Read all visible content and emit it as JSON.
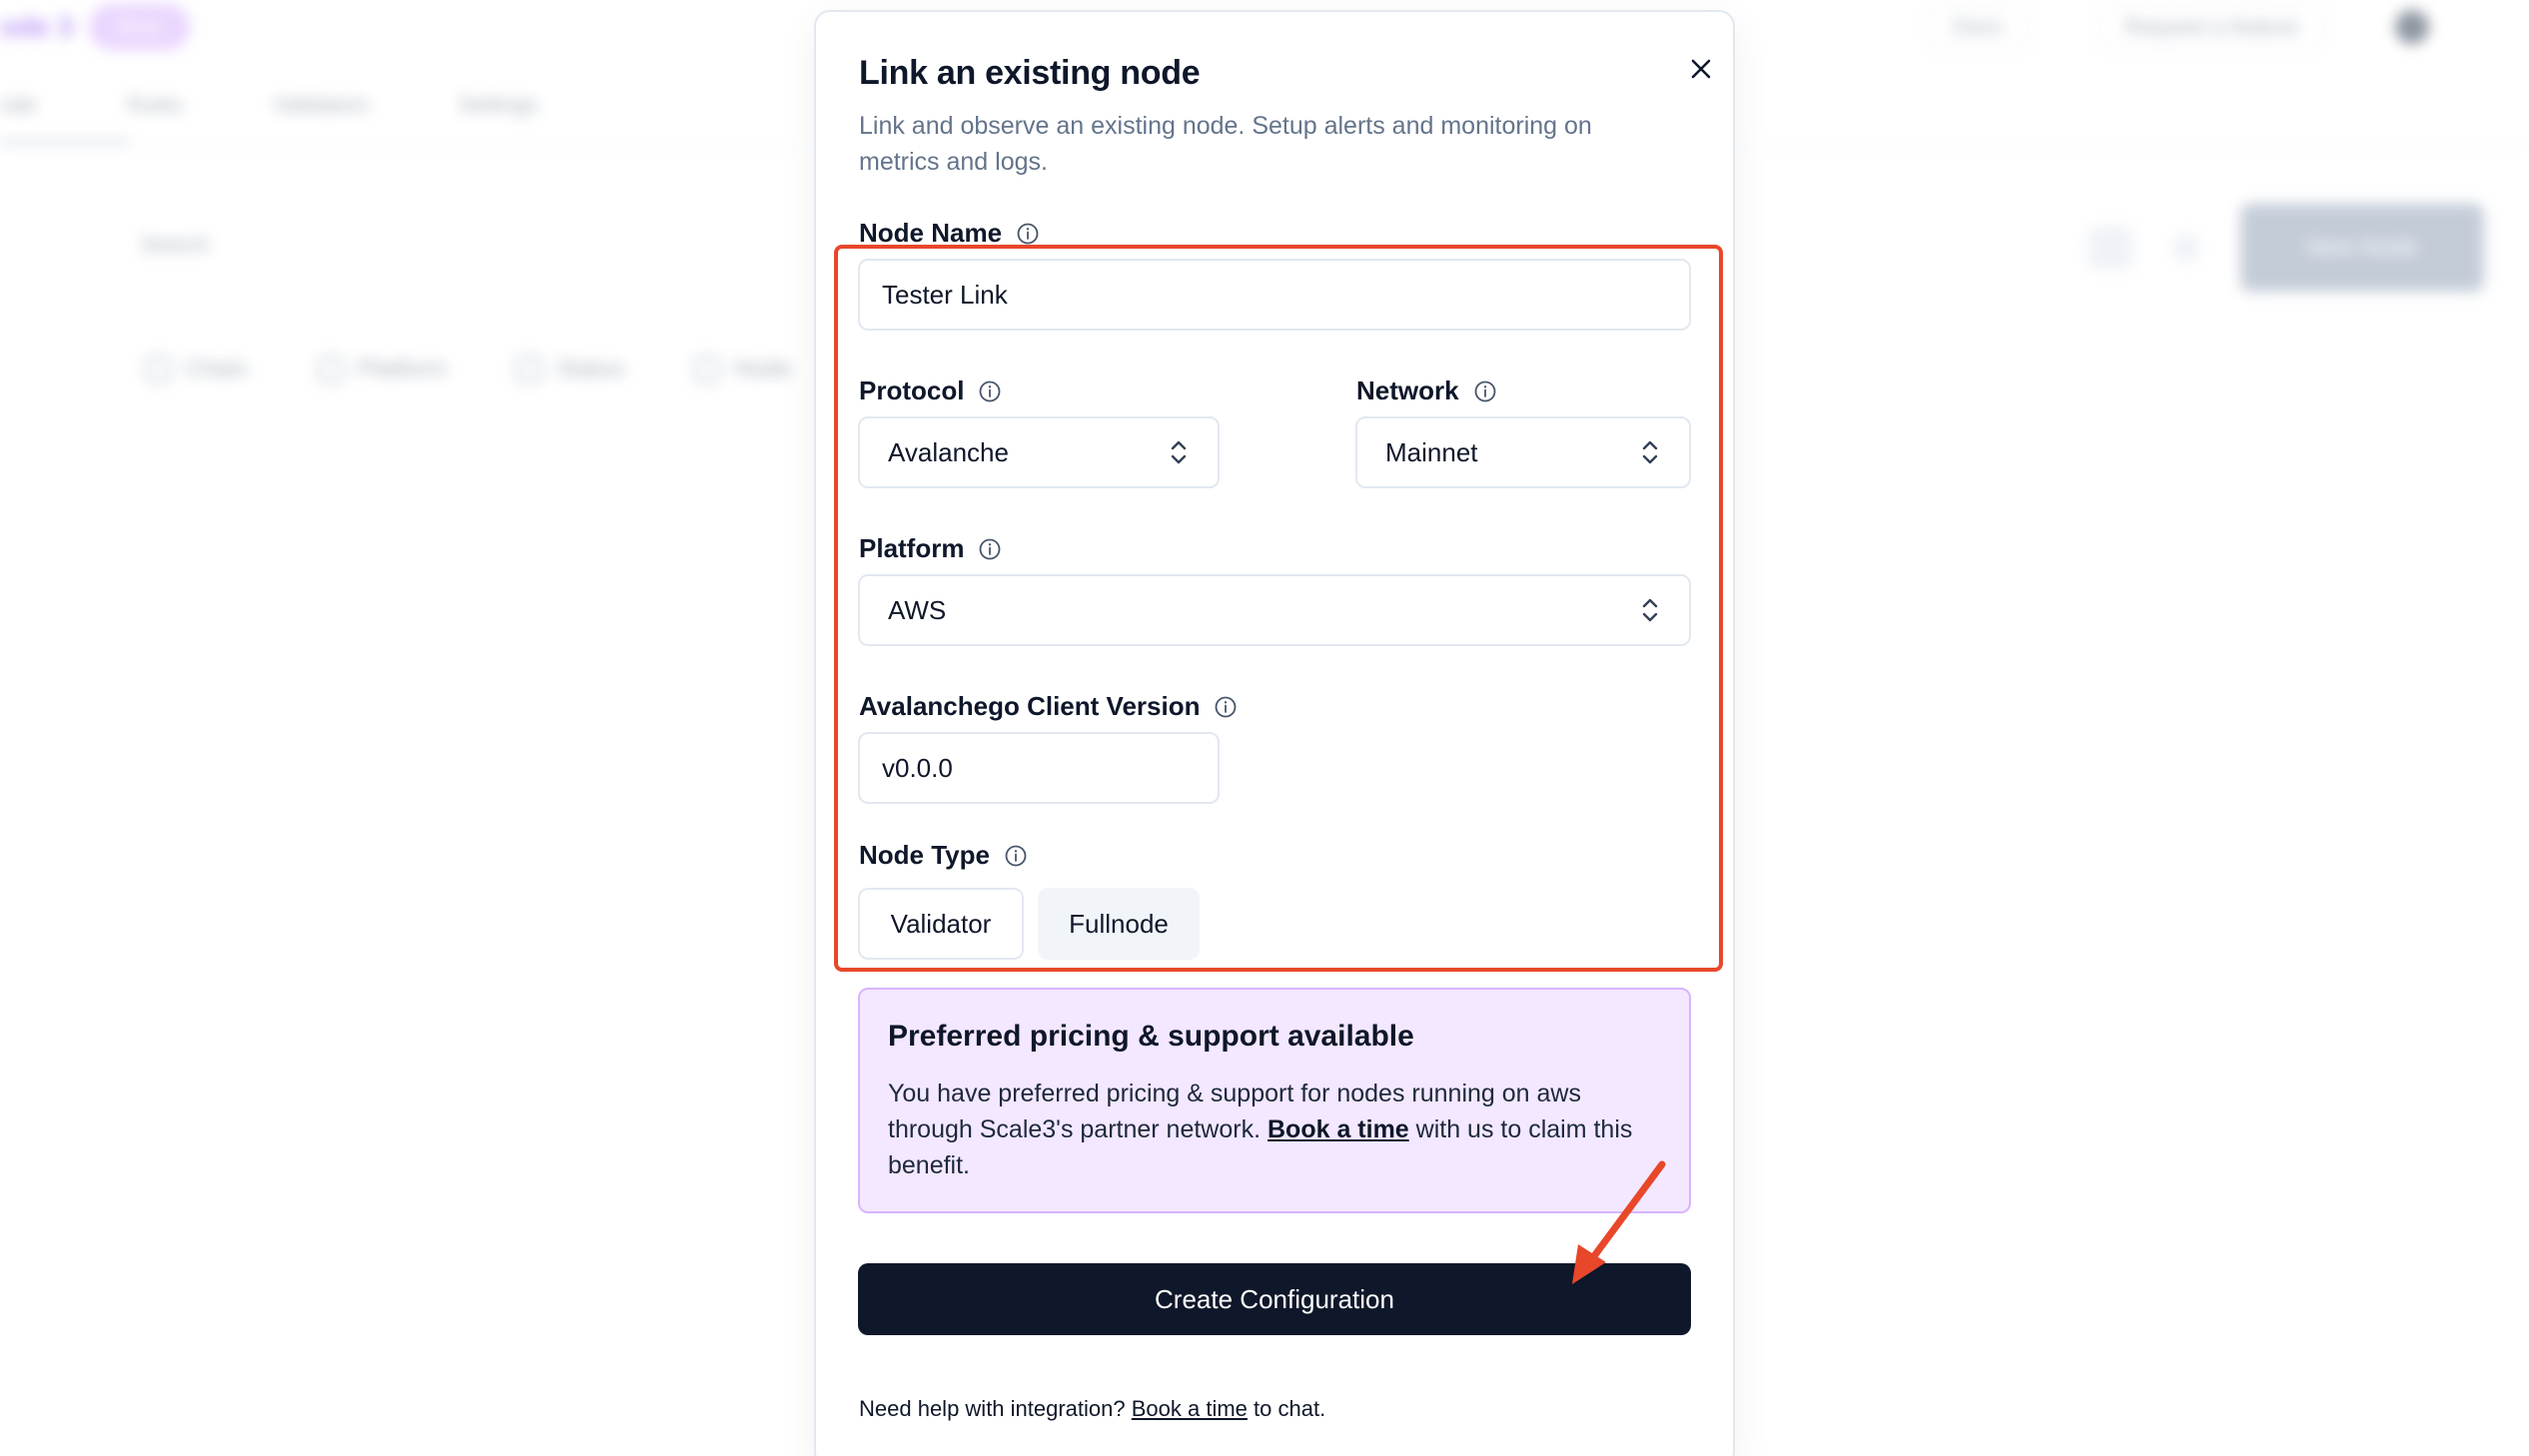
{
  "background": {
    "brand": "ode 3",
    "badge": "Beta",
    "top_buttons": [
      "Docs",
      "Request a feature"
    ],
    "tabs": [
      "ode",
      "Rules",
      "Validators",
      "Settings"
    ],
    "search_placeholder": "Search",
    "filters": [
      "Chain",
      "Platform",
      "Status",
      "Node"
    ],
    "new_button": "New Node"
  },
  "modal": {
    "title": "Link an existing node",
    "description": "Link and observe an existing node. Setup alerts and monitoring on metrics and logs.",
    "close_icon": "close-icon",
    "node_name": {
      "label": "Node Name",
      "value": "Tester Link"
    },
    "protocol": {
      "label": "Protocol",
      "value": "Avalanche"
    },
    "network": {
      "label": "Network",
      "value": "Mainnet"
    },
    "platform": {
      "label": "Platform",
      "value": "AWS"
    },
    "client_version": {
      "label": "Avalanchego Client Version",
      "value": "v0.0.0"
    },
    "node_type": {
      "label": "Node Type",
      "options": [
        "Validator",
        "Fullnode"
      ],
      "selected": "Fullnode"
    },
    "promo": {
      "title": "Preferred pricing & support available",
      "text_before": "You have preferred pricing & support for nodes running on aws through Scale3's partner network.",
      "link": "Book a time",
      "text_after": "with us to claim this benefit."
    },
    "create_button": "Create Configuration",
    "help": {
      "text_before": "Need help with integration?",
      "link": "Book a time",
      "text_after": "to chat."
    }
  },
  "colors": {
    "primary_dark": "#0f172a",
    "highlight": "#e8472a",
    "promo_bg": "#f3e8ff",
    "promo_border": "#d8b4fe"
  }
}
